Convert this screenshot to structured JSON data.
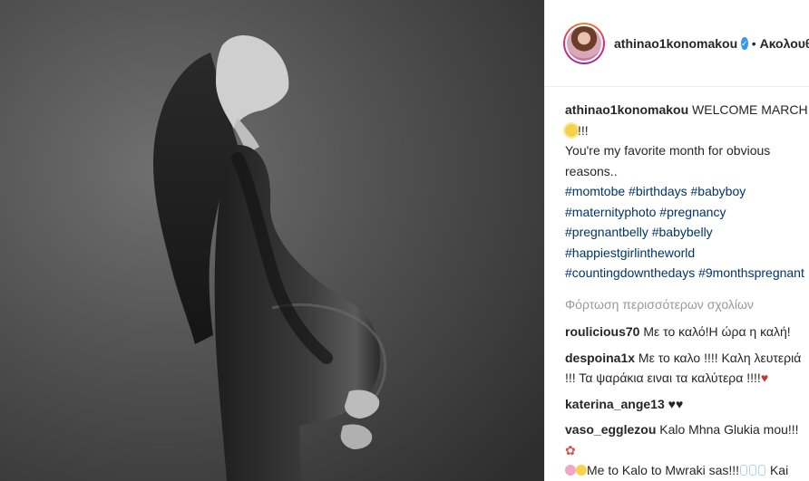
{
  "post": {
    "username": "athinao1konomakou",
    "follow_label": "Ακολουθ",
    "separator": "•"
  },
  "caption": {
    "author": "athinao1konomakou",
    "line1": "WELCOME MARCH",
    "line2": "!!!",
    "line3": "You're my favorite month for obvious reasons..",
    "hashtags": [
      "#momtobe #birthdays #babyboy",
      "#maternityphoto #pregnancy",
      "#pregnantbelly #babybelly",
      "#happiestgirlintheworld",
      "#countingdownthedays #9monthspregnant"
    ]
  },
  "load_more_label": "Φόρτωση περισσότερων σχολίων",
  "comments": [
    {
      "user": "roulicious70",
      "text": "Με το καλό!Η ώρα η καλή!"
    },
    {
      "user": "despoina1x",
      "text": "Με το καλο !!!! Καλη λευτεριά !!! Τα ψαράκια ειναι τα καλύτερα !!!!"
    },
    {
      "user": "katerina_ange13",
      "text": "♥♥"
    },
    {
      "user": "vaso_egglezou",
      "text": "Kalo Mhna Glukia mou!!!",
      "text2": "Me to Kalo to Mwraki sas!!!",
      "text3": "Kai Xairomai pou tha einai lytheis pews k"
    }
  ],
  "icons": {
    "verified": "verified-badge-icon",
    "sun": "sun-emoji-icon",
    "heart": "broken-heart-emoji-icon"
  },
  "colors": {
    "hashtag": "#003569",
    "verified": "#3897f0",
    "muted": "#999999"
  }
}
